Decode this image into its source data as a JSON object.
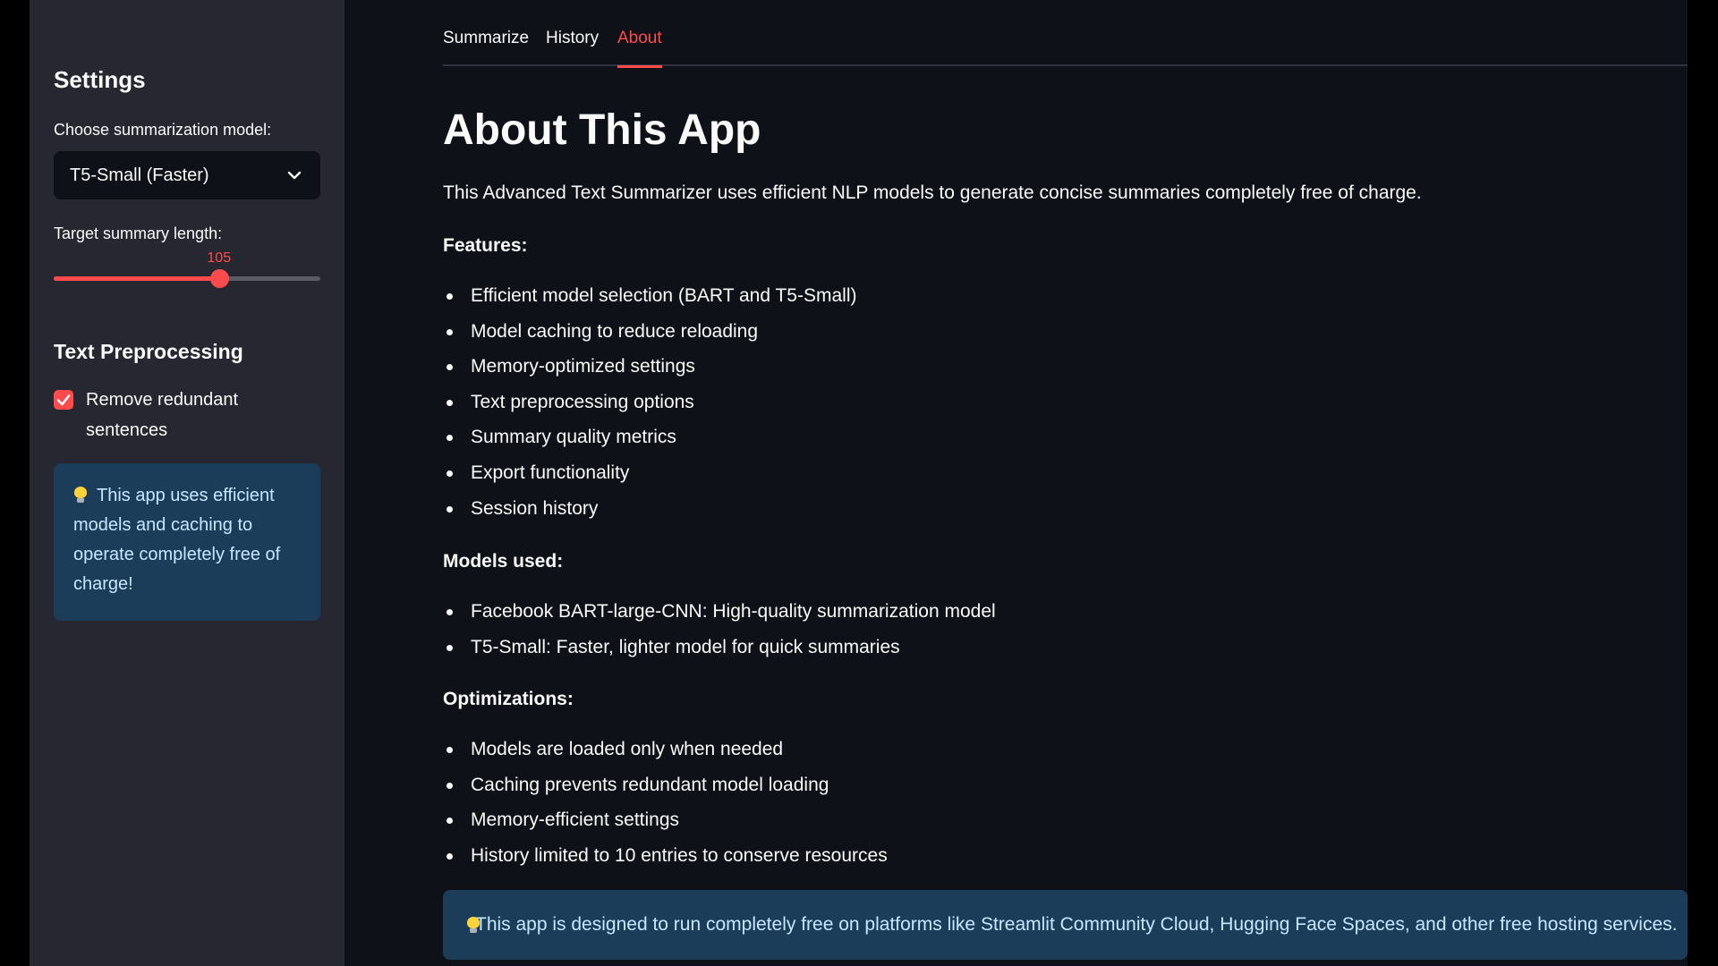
{
  "sidebar": {
    "title": "Settings",
    "model_label": "Choose summarization model:",
    "model_selected": "T5-Small (Faster)",
    "length_label": "Target summary length:",
    "length_value": "105",
    "length_fraction": 0.62,
    "preprocessing_title": "Text Preprocessing",
    "remove_redundant_label": "Remove redundant sentences",
    "remove_redundant_checked": true,
    "info_text": "This app uses efficient models and caching to operate completely free of charge!"
  },
  "tabs": [
    {
      "label": "Summarize",
      "active": false
    },
    {
      "label": "History",
      "active": false
    },
    {
      "label": "About",
      "active": true
    }
  ],
  "about": {
    "title": "About This App",
    "intro": "This Advanced Text Summarizer uses efficient NLP models to generate concise summaries completely free of charge.",
    "features_title": "Features:",
    "features": [
      "Efficient model selection (BART and T5-Small)",
      "Model caching to reduce reloading",
      "Memory-optimized settings",
      "Text preprocessing options",
      "Summary quality metrics",
      "Export functionality",
      "Session history"
    ],
    "models_title": "Models used:",
    "models": [
      "Facebook BART-large-CNN: High-quality summarization model",
      "T5-Small: Faster, lighter model for quick summaries"
    ],
    "optimizations_title": "Optimizations:",
    "optimizations": [
      "Models are loaded only when needed",
      "Caching prevents redundant model loading",
      "Memory-efficient settings",
      "History limited to 10 entries to conserve resources"
    ],
    "info_text": "This app is designed to run completely free on platforms like Streamlit Community Cloud, Hugging Face Spaces, and other free hosting services."
  },
  "colors": {
    "accent": "#ff4b4b",
    "sidebar_bg": "#262730",
    "main_bg": "#0e1117",
    "info_bg": "#1c3d5a",
    "info_text": "#c7e6ff"
  },
  "icons": {
    "select_chevron": "chevron-down-icon",
    "checkbox_mark": "check-icon",
    "info_icon": "lightbulb-icon"
  }
}
